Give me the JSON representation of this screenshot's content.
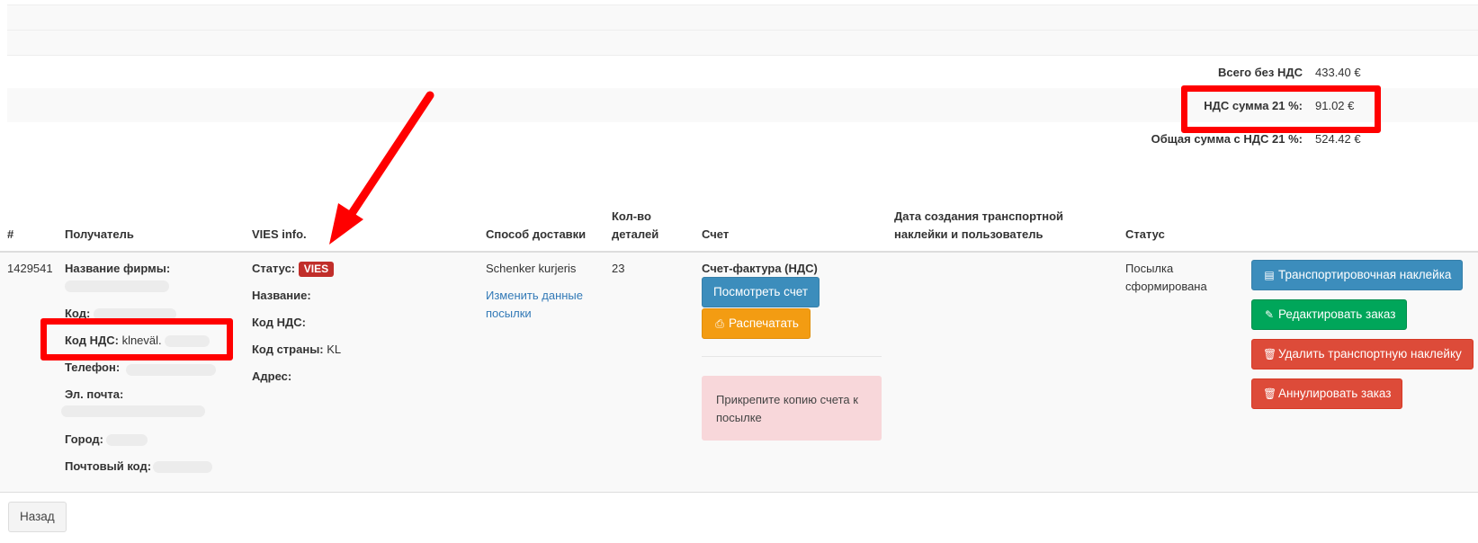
{
  "totals": [
    {
      "label": "Всего без НДС",
      "value": "433.40 €"
    },
    {
      "label": "НДС сумма 21 %:",
      "value": "91.02 €"
    },
    {
      "label": "Общая сумма с НДС 21 %:",
      "value": "524.42 €"
    }
  ],
  "table": {
    "headers": {
      "num": "#",
      "recipient": "Получатель",
      "vies": "VIES info.",
      "delivery": "Способ доставки",
      "qty_line1": "Кол-во",
      "qty_line2": "деталей",
      "invoice": "Счет",
      "date_line1": "Дата создания транспортной",
      "date_line2": "наклейки и пользователь",
      "status": "Статус"
    },
    "row": {
      "id": "1429541",
      "recipient": {
        "company_label": "Название фирмы:",
        "code_label": "Код:",
        "vat_label": "Код НДС:",
        "vat_value": "klneväl.",
        "phone_label": "Телефон:",
        "email_label": "Эл. почта:",
        "city_label": "Город:",
        "zip_label": "Почтовый код:"
      },
      "vies": {
        "status_label": "Статус:",
        "status_badge": "VIES",
        "name_label": "Название:",
        "vat_label": "Код НДС:",
        "country_label": "Код страны:",
        "country_value": "KL",
        "address_label": "Адрес:"
      },
      "delivery": {
        "method": "Schenker kurjeris",
        "change_link_line1": "Изменить данные",
        "change_link_line2": "посылки"
      },
      "qty": "23",
      "invoice": {
        "title": "Счет-фактура (НДС)",
        "view_button": "Посмотреть счет",
        "print_button": "Распечатать",
        "alert": "Прикрепите копию счета к посылке"
      },
      "status_line1": "Посылка",
      "status_line2": "сформирована",
      "actions": {
        "label_button": "Транспортировочная наклейка",
        "edit_button": "Редактировать заказ",
        "delete_label_button": "Удалить транспортную наклейку",
        "cancel_button": "Аннулировать заказ"
      }
    }
  },
  "back_button": "Назад",
  "annotation_color": "#ff0000",
  "icons": {
    "label": "newspaper-icon",
    "edit": "edit-icon",
    "delete": "trash-icon",
    "print": "print-icon"
  }
}
